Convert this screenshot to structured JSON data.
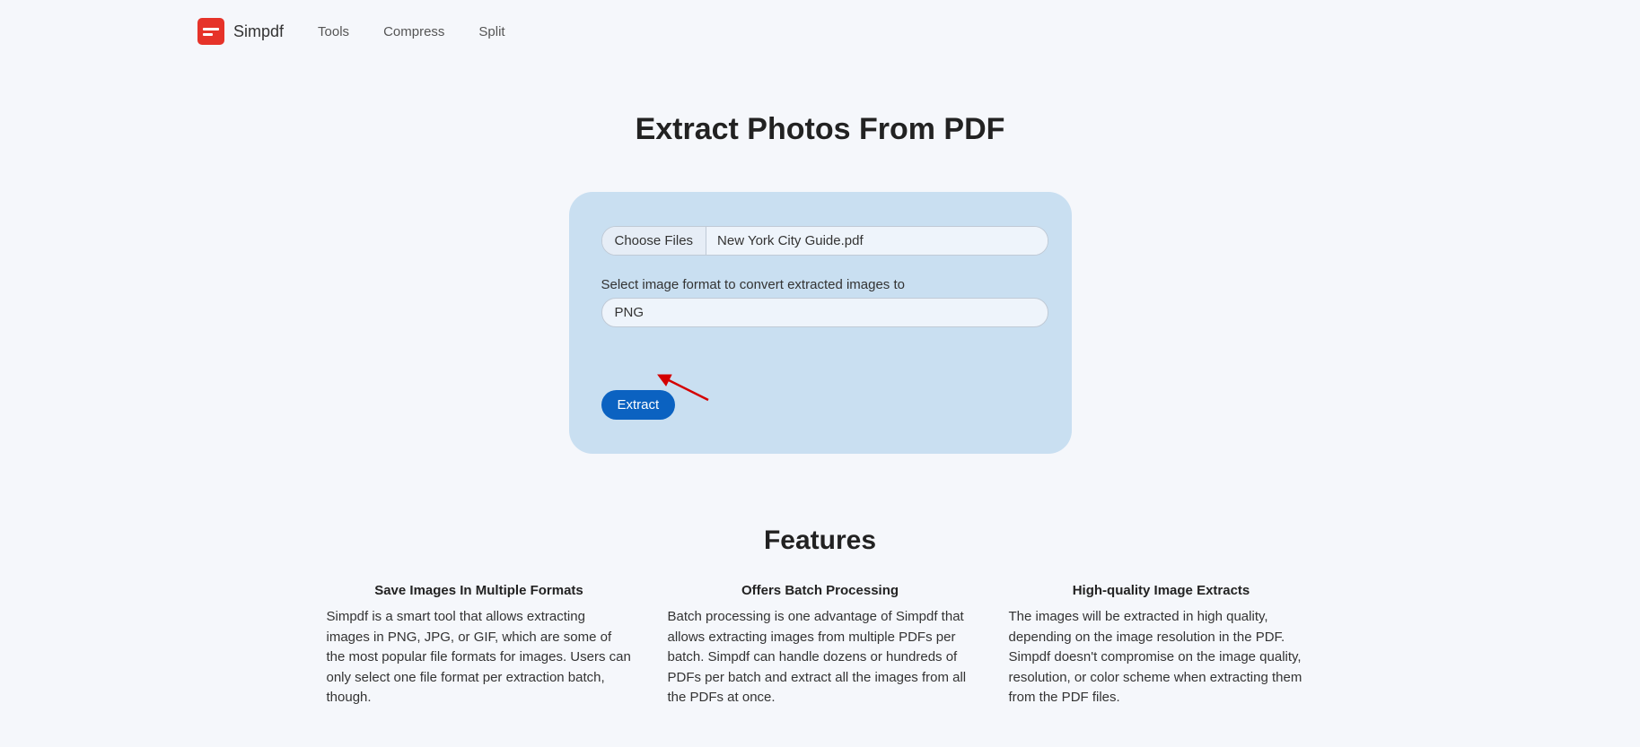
{
  "brand": {
    "name": "Simpdf"
  },
  "nav": {
    "tools": "Tools",
    "compress": "Compress",
    "split": "Split"
  },
  "page": {
    "title": "Extract Photos From PDF"
  },
  "panel": {
    "choose_label": "Choose Files",
    "file_name": "New York City Guide.pdf",
    "format_label": "Select image format to convert extracted images to",
    "format_value": "PNG",
    "extract_label": "Extract"
  },
  "features": {
    "title": "Features",
    "items": [
      {
        "heading": "Save Images In Multiple Formats",
        "body": "Simpdf is a smart tool that allows extracting images in PNG, JPG, or GIF, which are some of the most popular file formats for images. Users can only select one file format per extraction batch, though."
      },
      {
        "heading": "Offers Batch Processing",
        "body": "Batch processing is one advantage of Simpdf that allows extracting images from multiple PDFs per batch. Simpdf can handle dozens or hundreds of PDFs per batch and extract all the images from all the PDFs at once."
      },
      {
        "heading": "High-quality Image Extracts",
        "body": "The images will be extracted in high quality, depending on the image resolution in the PDF. Simpdf doesn't compromise on the image quality, resolution, or color scheme when extracting them from the PDF files."
      }
    ]
  }
}
